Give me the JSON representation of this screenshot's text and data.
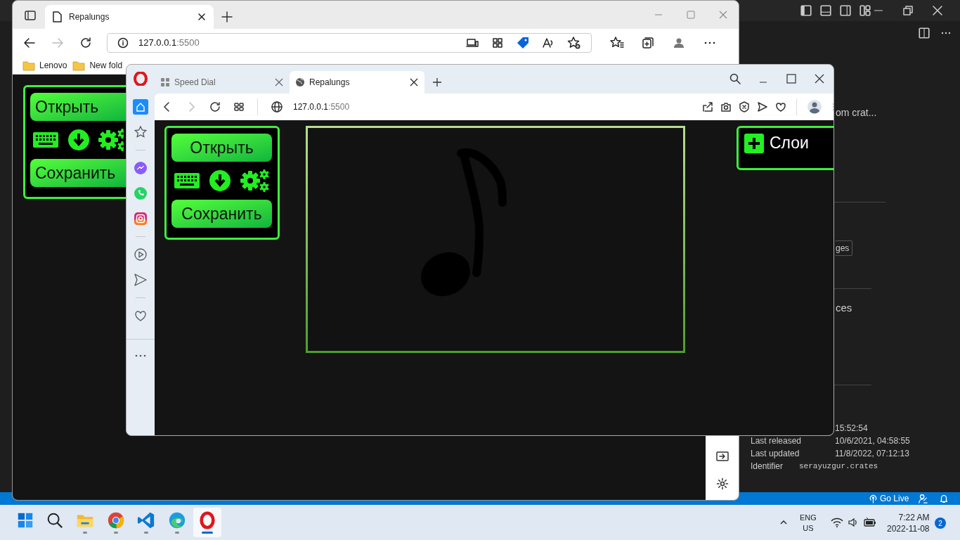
{
  "vscode": {
    "panel_texts": [
      "om crat...",
      "ces"
    ],
    "badge_button": "ges",
    "details": [
      {
        "value": "15:52:54"
      },
      {
        "label": "Last released",
        "value": "10/6/2021, 04:58:55"
      },
      {
        "label": "Last updated",
        "value": "11/8/2022, 07:12:13"
      },
      {
        "label": "Identifier",
        "value": "serayuzgur.crates",
        "kind": "code"
      }
    ],
    "status_bar": {
      "go_live": "Go Live"
    }
  },
  "edge": {
    "tabs": [
      {
        "label": "Repalungs",
        "selected": true
      }
    ],
    "address": {
      "host": "127.0.0.1",
      "port": ":5500"
    },
    "bookmarks": [
      {
        "label": "Lenovo"
      },
      {
        "label": "New fold"
      }
    ],
    "app": {
      "open_button": "Открыть",
      "save_button": "Сохранить"
    }
  },
  "opera": {
    "tabs": [
      {
        "label": "Speed Dial",
        "selected": false
      },
      {
        "label": "Repalungs",
        "selected": true
      }
    ],
    "address": {
      "host": "127.0.0.1",
      "port": ":5500"
    },
    "sidebar": [
      {
        "kind": "home",
        "selected": true
      },
      {
        "kind": "star",
        "selected": false
      },
      {
        "kind": "messenger",
        "selected": false
      },
      {
        "kind": "whatsapp",
        "selected": false
      },
      {
        "kind": "instagram",
        "selected": false
      },
      {
        "kind": "player",
        "selected": false
      },
      {
        "kind": "send",
        "selected": false
      },
      {
        "kind": "heart",
        "selected": false
      }
    ],
    "app": {
      "open_button": "Открыть",
      "save_button": "Сохранить",
      "layers_button": "Слои"
    }
  },
  "taskbar": {
    "apps": [
      {
        "kind": "start",
        "open": false,
        "selected": false
      },
      {
        "kind": "search",
        "open": false,
        "selected": false
      },
      {
        "kind": "explorer",
        "open": true,
        "selected": false
      },
      {
        "kind": "chrome",
        "open": true,
        "selected": false
      },
      {
        "kind": "vscode",
        "open": true,
        "selected": false
      },
      {
        "kind": "edge",
        "open": true,
        "selected": false
      },
      {
        "kind": "opera",
        "open": true,
        "selected": true
      }
    ],
    "language": "ENG",
    "region": "US",
    "time": "7:22 AM",
    "date": "2022-11-08",
    "notifications": "2"
  }
}
